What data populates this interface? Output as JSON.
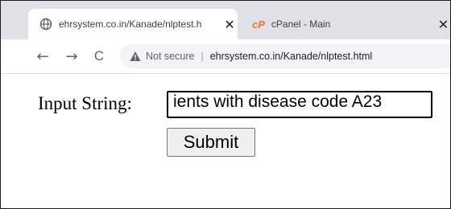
{
  "browser": {
    "tabs": [
      {
        "title": "ehrsystem.co.in/Kanade/nlptest.h",
        "icon": "globe-icon",
        "active": true
      },
      {
        "title": "cPanel - Main",
        "icon": "cpanel-icon",
        "active": false
      }
    ],
    "tab_close_glyph": "✕",
    "cpanel_glyph": "cP",
    "nav": {
      "back": "←",
      "forward": "→",
      "reload": "C"
    },
    "address": {
      "security": "Not secure",
      "separator": "|",
      "url": "ehrsystem.co.in/Kanade/nlptest.html"
    }
  },
  "form": {
    "label": "Input String:",
    "input_value": "ients with disease code A23",
    "submit_label": "Submit"
  }
}
